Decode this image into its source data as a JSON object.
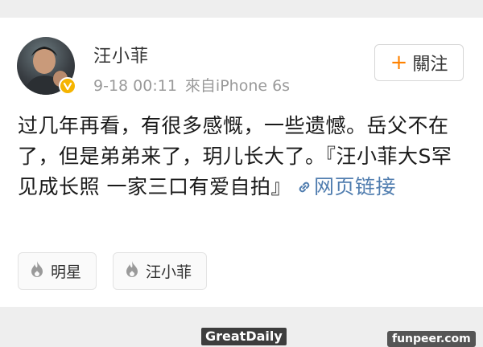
{
  "post": {
    "username": "汪小菲",
    "time": "9-18 00:11",
    "source": "來自iPhone 6s",
    "follow_plus": "+",
    "follow_label": "關注",
    "text": "过几年再看，有很多感慨，一些遗憾。岳父不在了，但是弟弟来了，玥儿长大了。『汪小菲大S罕见成长照 一家三口有爱自拍』",
    "link_label": "网页链接"
  },
  "tags": [
    {
      "label": "明星"
    },
    {
      "label": "汪小菲"
    }
  ],
  "watermarks": {
    "left": "GreatDaily",
    "right": "funpeer.com"
  },
  "icons": {
    "verified": "verified-badge-icon",
    "link": "link-icon",
    "tag": "flame-icon"
  },
  "colors": {
    "accent": "#ff8200",
    "link": "#507daf",
    "verified": "#f5b400",
    "meta_text": "#9a9a9a"
  }
}
